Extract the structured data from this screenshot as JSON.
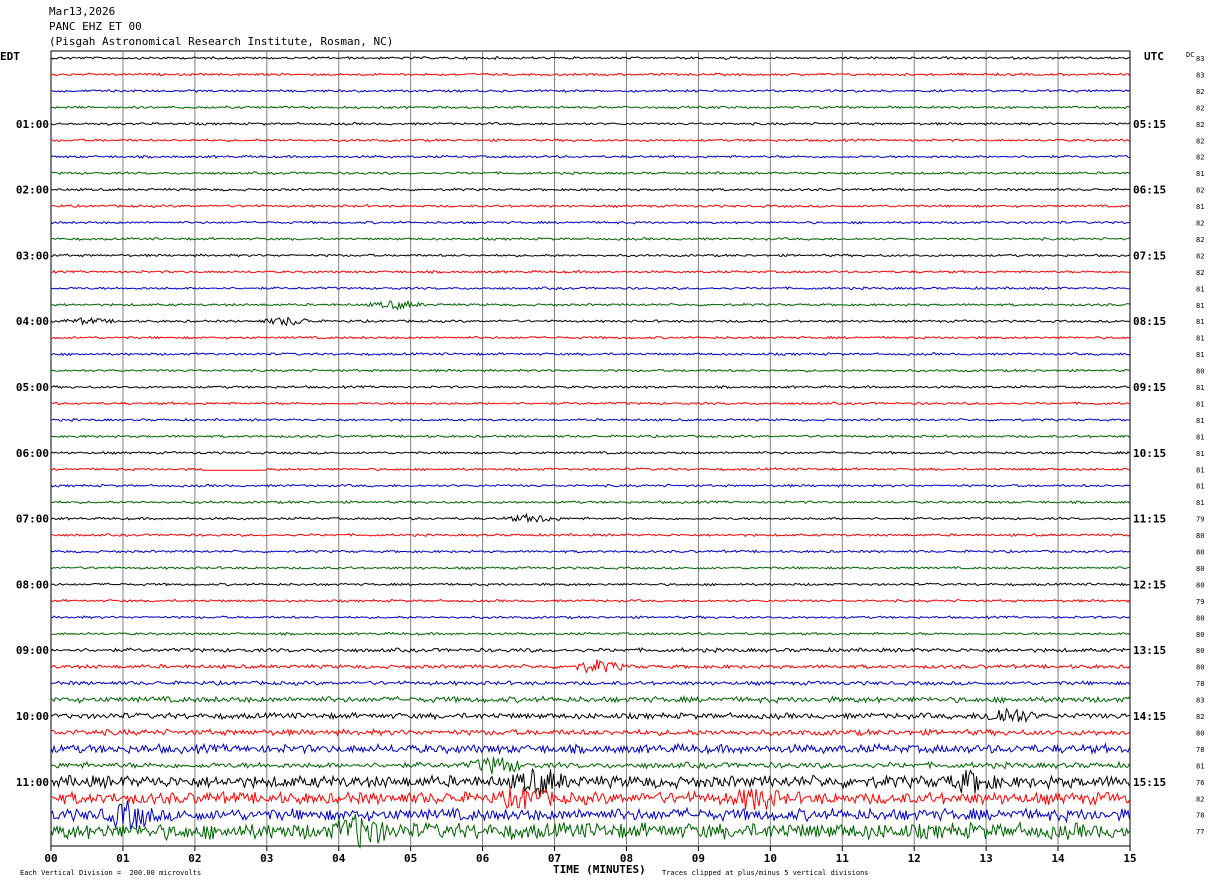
{
  "header": {
    "date": "Mar13,2026",
    "station": "PANC EHZ ET 00",
    "location": "(Pisgah Astronomical Research Institute, Rosman, NC)"
  },
  "left_zone": "EDT",
  "right_zone": "UTC",
  "dc_label": "DC",
  "footer": {
    "scale": "Each Vertical Division =  200.00 microvolts",
    "clip": "Traces clipped at plus/minus 5 vertical divisions"
  },
  "colors": {
    "trace": [
      "#000000",
      "#ff0000",
      "#0000c8",
      "#006400"
    ],
    "grid": "#808080"
  },
  "chart_data": {
    "type": "line",
    "title": "PANC EHZ ET 00",
    "xlabel": "TIME (MINUTES)",
    "ylabel": "",
    "x_ticks": [
      "00",
      "01",
      "02",
      "03",
      "04",
      "05",
      "06",
      "07",
      "08",
      "09",
      "10",
      "11",
      "12",
      "13",
      "14",
      "15"
    ],
    "xlim": [
      0,
      15
    ],
    "left_hour_labels": [
      "01:00",
      "02:00",
      "03:00",
      "04:00",
      "05:00",
      "06:00",
      "07:00",
      "08:00",
      "09:00",
      "10:00",
      "11:00"
    ],
    "right_hour_labels": [
      "05:15",
      "06:15",
      "07:15",
      "08:15",
      "09:15",
      "10:15",
      "11:15",
      "12:15",
      "13:15",
      "14:15",
      "15:15"
    ],
    "trace_count": 48,
    "dc_offsets": [
      "83",
      "83",
      "82",
      "82",
      "82",
      "82",
      "82",
      "81",
      "82",
      "81",
      "82",
      "82",
      "82",
      "82",
      "81",
      "81",
      "81",
      "81",
      "81",
      "80",
      "81",
      "81",
      "81",
      "81",
      "81",
      "81",
      "81",
      "81",
      "79",
      "80",
      "80",
      "80",
      "80",
      "79",
      "80",
      "80",
      "80",
      "80",
      "78",
      "83",
      "82",
      "80",
      "78",
      "81",
      "76",
      "82",
      "78",
      "77"
    ],
    "amplitude_level": [
      1,
      1,
      1,
      1,
      1,
      1,
      1,
      1,
      1,
      1,
      1,
      1,
      1,
      1,
      1,
      1,
      1,
      1,
      1,
      1,
      1,
      1,
      1,
      1,
      1,
      1,
      1,
      1,
      1,
      1,
      1,
      1,
      1,
      1,
      1,
      1,
      2,
      2,
      2,
      3,
      3,
      3,
      4,
      3,
      5,
      5,
      5,
      6
    ],
    "events": [
      {
        "trace": 15,
        "minute": 4.8,
        "level": 3
      },
      {
        "trace": 16,
        "minute": 0.5,
        "level": 2
      },
      {
        "trace": 16,
        "minute": 3.3,
        "level": 3
      },
      {
        "trace": 28,
        "minute": 6.7,
        "level": 3
      },
      {
        "trace": 37,
        "minute": 7.6,
        "level": 4
      },
      {
        "trace": 40,
        "minute": 13.3,
        "level": 5
      },
      {
        "trace": 43,
        "minute": 6.2,
        "level": 5
      },
      {
        "trace": 44,
        "minute": 6.8,
        "level": 6
      },
      {
        "trace": 44,
        "minute": 12.8,
        "level": 5
      },
      {
        "trace": 45,
        "minute": 6.6,
        "level": 5
      },
      {
        "trace": 45,
        "minute": 9.8,
        "level": 5
      },
      {
        "trace": 46,
        "minute": 1.1,
        "level": 6
      },
      {
        "trace": 47,
        "minute": 4.3,
        "level": 7
      }
    ],
    "gaps": [
      {
        "trace": 25,
        "start": 2.1,
        "end": 3.0
      }
    ]
  }
}
